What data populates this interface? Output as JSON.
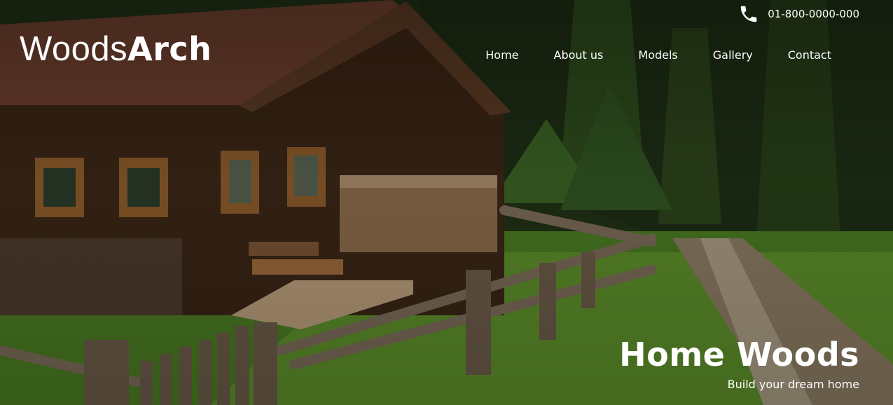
{
  "brand": {
    "logo_light": "Woods",
    "logo_bold": "Arch"
  },
  "contact": {
    "phone_icon": "phone-icon",
    "phone": "01-800-0000-000"
  },
  "nav": {
    "items": [
      {
        "label": "Home"
      },
      {
        "label": "About us"
      },
      {
        "label": "Models"
      },
      {
        "label": "Gallery"
      },
      {
        "label": "Contact"
      }
    ]
  },
  "hero": {
    "title": "Home Woods",
    "subtitle": "Build your dream home",
    "image": "hero-background-image"
  },
  "colors": {
    "text": "#ffffff",
    "grass": "#4e7d24",
    "wood": "#6b4a2b",
    "roof": "#7a4a36"
  }
}
